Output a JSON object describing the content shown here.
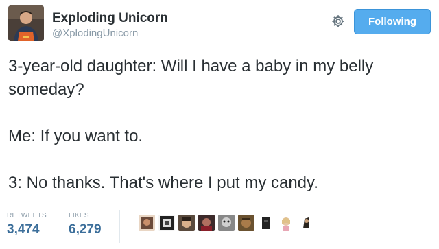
{
  "user": {
    "display_name": "Exploding Unicorn",
    "screen_name": "@XplodingUnicorn"
  },
  "actions": {
    "settings_icon": "gear-icon",
    "follow_label": "Following",
    "follow_color": "#55acee"
  },
  "tweet": {
    "paragraphs": [
      "3-year-old daughter: Will I have a baby in my belly someday?",
      "Me: If you want to.",
      "3: No thanks. That's where I put my candy."
    ]
  },
  "stats": {
    "retweets_label": "RETWEETS",
    "retweets_count": "3,474",
    "likes_label": "LIKES",
    "likes_count": "6,279"
  },
  "colors": {
    "link_blue": "#3b6e9a",
    "muted": "#8899a6",
    "text": "#292f33"
  }
}
